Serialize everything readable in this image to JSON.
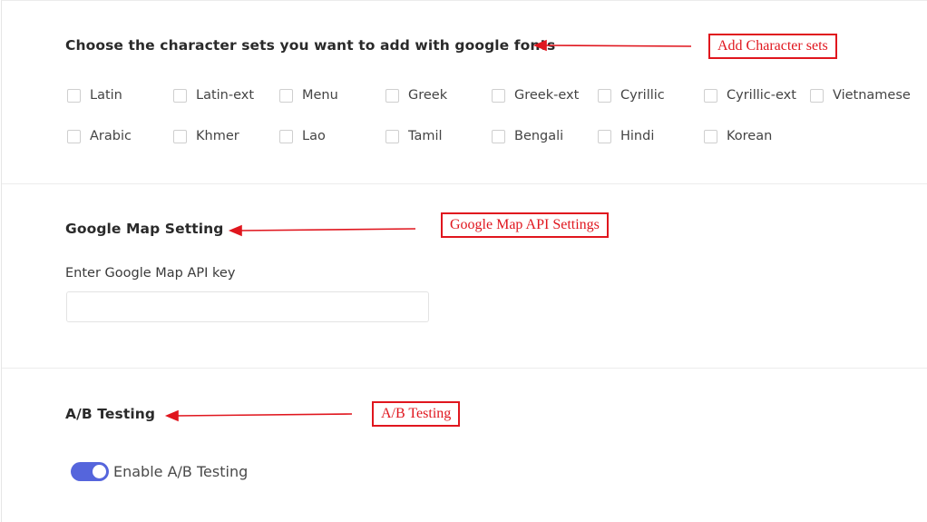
{
  "charsets": {
    "title": "Choose the character sets you want to add with google fonts",
    "row1": [
      "Latin",
      "Latin-ext",
      "Menu",
      "Greek",
      "Greek-ext",
      "Cyrillic",
      "Cyrillic-ext",
      "Vietnamese"
    ],
    "row2": [
      "Arabic",
      "Khmer",
      "Lao",
      "Tamil",
      "Bengali",
      "Hindi",
      "Korean"
    ]
  },
  "google_map": {
    "title": "Google Map Setting",
    "field_label": "Enter Google Map API key",
    "api_key_value": ""
  },
  "ab_testing": {
    "title": "A/B Testing",
    "toggle_label": "Enable A/B Testing",
    "enabled": true
  },
  "annotations": {
    "character_sets": "Add Character sets",
    "google_map": "Google Map API Settings",
    "ab_testing": "A/B Testing",
    "color": "#e0161e"
  },
  "colors": {
    "toggle_on": "#5565dc"
  }
}
